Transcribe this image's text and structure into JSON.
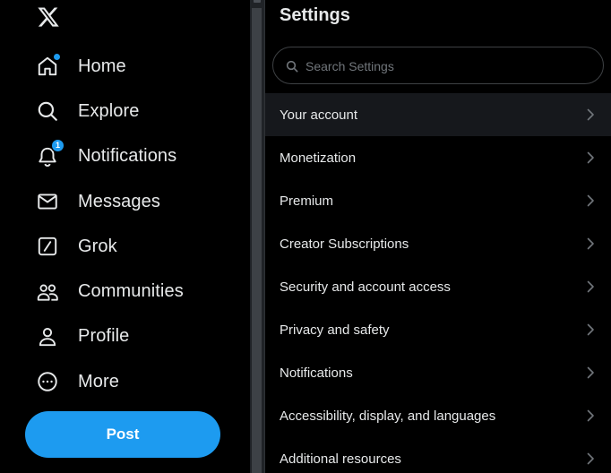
{
  "sidebar": {
    "logo_icon": "x-logo-icon",
    "nav": [
      {
        "label": "Home",
        "icon": "home-icon",
        "indicator": "dot"
      },
      {
        "label": "Explore",
        "icon": "search-icon"
      },
      {
        "label": "Notifications",
        "icon": "bell-icon",
        "badge": "1"
      },
      {
        "label": "Messages",
        "icon": "envelope-icon"
      },
      {
        "label": "Grok",
        "icon": "grok-icon"
      },
      {
        "label": "Communities",
        "icon": "people-icon"
      },
      {
        "label": "Profile",
        "icon": "person-icon"
      },
      {
        "label": "More",
        "icon": "more-circle-icon"
      }
    ],
    "post_label": "Post"
  },
  "settings": {
    "title": "Settings",
    "search_placeholder": "Search Settings",
    "items": [
      {
        "label": "Your account",
        "active": true
      },
      {
        "label": "Monetization"
      },
      {
        "label": "Premium"
      },
      {
        "label": "Creator Subscriptions"
      },
      {
        "label": "Security and account access"
      },
      {
        "label": "Privacy and safety"
      },
      {
        "label": "Notifications"
      },
      {
        "label": "Accessibility, display, and languages"
      },
      {
        "label": "Additional resources"
      }
    ]
  },
  "colors": {
    "background": "#000000",
    "accent": "#1d9bf0",
    "text": "#e7e9ea",
    "muted": "#71767b",
    "active_row": "#16181c",
    "border": "#2f3336"
  }
}
